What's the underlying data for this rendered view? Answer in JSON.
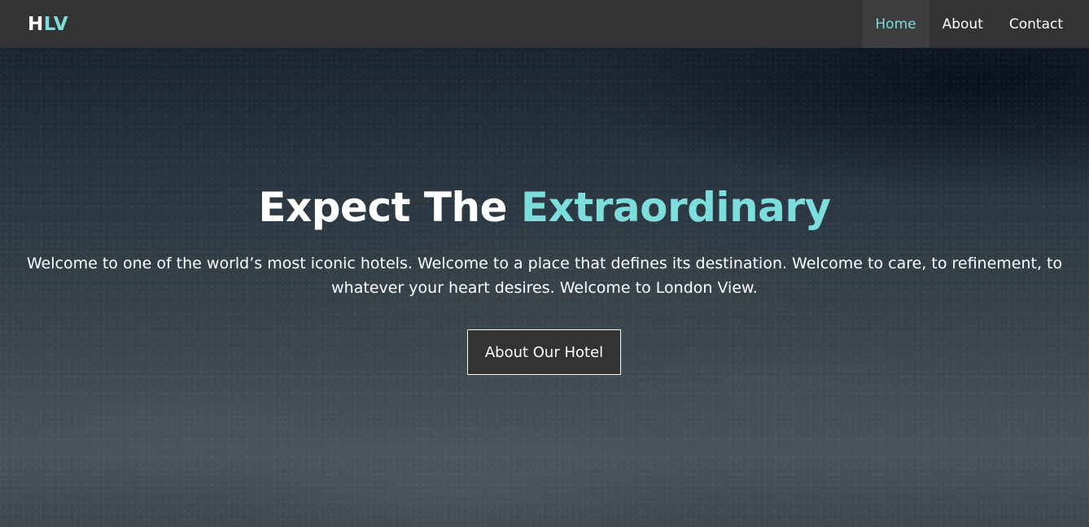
{
  "navbar": {
    "logo_h": "H",
    "logo_lv": "LV",
    "links": [
      {
        "label": "Home",
        "active": true
      },
      {
        "label": "About",
        "active": false
      },
      {
        "label": "Contact",
        "active": false
      }
    ]
  },
  "hero": {
    "title_main": "Expect The ",
    "title_accent": "Extraordinary",
    "text": "Welcome to one of the world’s most iconic hotels. Welcome to a place that defines its destination. Welcome to care, to refinement, to whatever your heart desires. Welcome to London View.",
    "button_label": "About Our Hotel"
  },
  "colors": {
    "accent": "#7ddcdc",
    "navbar_bg": "#333333",
    "button_bg": "#333333"
  }
}
